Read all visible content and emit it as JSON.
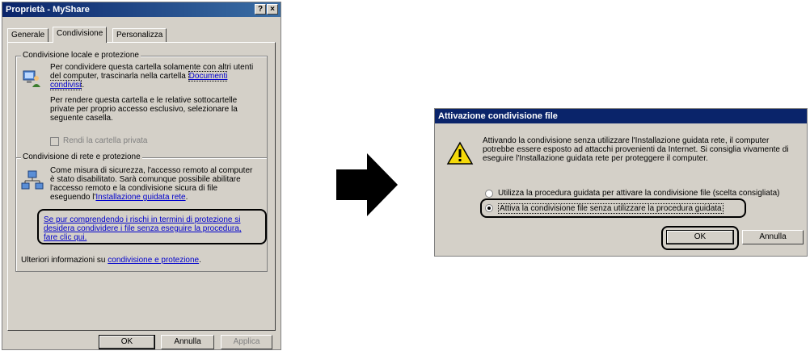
{
  "share_dialog": {
    "title": "Proprietà - MyShare",
    "help_button": "?",
    "close_button": "×",
    "tabs": [
      "Generale",
      "Condivisione",
      "Personalizza"
    ],
    "local_group": {
      "legend": "Condivisione locale e protezione",
      "text1": "Per condividere questa cartella solamente con altri utenti del computer, trascinarla nella cartella",
      "link1": "Documenti condivisi",
      "text2": "Per rendere questa cartella e le relative sottocartelle private per proprio accesso esclusivo, selezionare la seguente casella.",
      "checkbox_label": "Rendi la cartella privata"
    },
    "network_group": {
      "legend": "Condivisione di rete e protezione",
      "text1": "Come misura di sicurezza, l'accesso remoto al computer è stato disabilitato. Sarà comunque possibile abilitare l'accesso remoto e la condivisione sicura di file eseguendo l'",
      "link1": "Installazione guidata rete",
      "text1_end": ".",
      "link2": "Se pur comprendendo i rischi in termini di protezione si desidera condividere i file senza eseguire la procedura, fare clic qui."
    },
    "more_info_text": "Ulteriori informazioni su",
    "more_info_link": "condivisione e protezione",
    "more_info_end": ".",
    "buttons": {
      "ok": "OK",
      "cancel": "Annulla",
      "apply": "Applica"
    }
  },
  "enable_dialog": {
    "title": "Attivazione condivisione file",
    "warning_icon": "warning-icon",
    "message": "Attivando la condivisione senza utilizzare l'Installazione guidata rete, il computer potrebbe essere esposto ad attacchi provenienti da Internet. Si consiglia vivamente di eseguire l'Installazione guidata rete per proteggere il computer.",
    "option1": "Utilizza la procedura guidata per attivare la condivisione file (scelta consigliata)",
    "option2": "Attiva la condivisione file senza utilizzare la procedura guidata",
    "buttons": {
      "ok": "OK",
      "cancel": "Annulla"
    }
  },
  "colors": {
    "title_bar": "#0a246a",
    "face": "#d4d0c8",
    "link": "#0000cc"
  }
}
